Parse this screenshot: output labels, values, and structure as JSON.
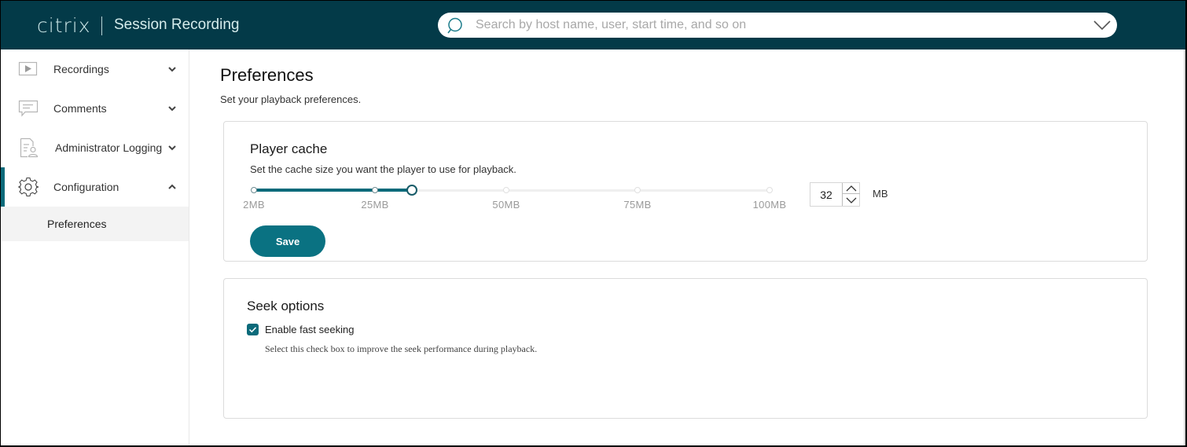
{
  "header": {
    "brand": "citrix",
    "app_title": "Session Recording",
    "search_placeholder": "Search by host name, user, start time, and so on",
    "search_value": ""
  },
  "sidebar": {
    "items": [
      {
        "label": "Recordings",
        "icon": "play-icon",
        "expanded": false
      },
      {
        "label": "Comments",
        "icon": "comment-icon",
        "expanded": false
      },
      {
        "label": "Administrator Logging",
        "icon": "admin-log-icon",
        "expanded": false
      },
      {
        "label": "Configuration",
        "icon": "gear-icon",
        "expanded": true,
        "active": true
      }
    ],
    "sub_items": [
      {
        "label": "Preferences",
        "selected": true
      }
    ]
  },
  "main": {
    "title": "Preferences",
    "subtitle": "Set your playback preferences.",
    "player_cache": {
      "title": "Player cache",
      "description": "Set the cache size you want the player to use for playback.",
      "slider": {
        "min": 2,
        "max": 100,
        "value": 32,
        "ticks": [
          2,
          25,
          50,
          75,
          100
        ],
        "tick_labels": [
          "2MB",
          "25MB",
          "50MB",
          "75MB",
          "100MB"
        ]
      },
      "stepper_value": "32",
      "unit": "MB",
      "save_label": "Save"
    },
    "seek_options": {
      "title": "Seek options",
      "checkbox_label": "Enable fast seeking",
      "checked": true,
      "help": "Select this check box to improve the seek performance during playback."
    }
  },
  "colors": {
    "header_bg": "#033a48",
    "accent": "#0b6a7a",
    "button": "#0a7282"
  }
}
